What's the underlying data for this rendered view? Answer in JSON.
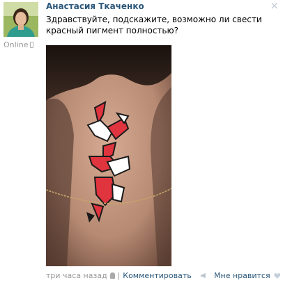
{
  "post": {
    "author_name": "Анастасия Ткаченко",
    "online_status": "Online",
    "text": "Здравствуйте, подскажите, возможно ли свести красный пигмент полностью?",
    "close_symbol": "×",
    "timestamp": "три часа назад",
    "separator": "|",
    "comment_label": "Комментировать",
    "like_label": "Мне нравится",
    "icons": {
      "avatar": "user-photo",
      "device": "mobile-phone-icon",
      "platform": "android-icon",
      "share": "megaphone-icon",
      "like": "heart-icon"
    },
    "colors": {
      "link": "#2b587a",
      "muted": "#999999",
      "tattoo_red": "#e0343e"
    }
  }
}
